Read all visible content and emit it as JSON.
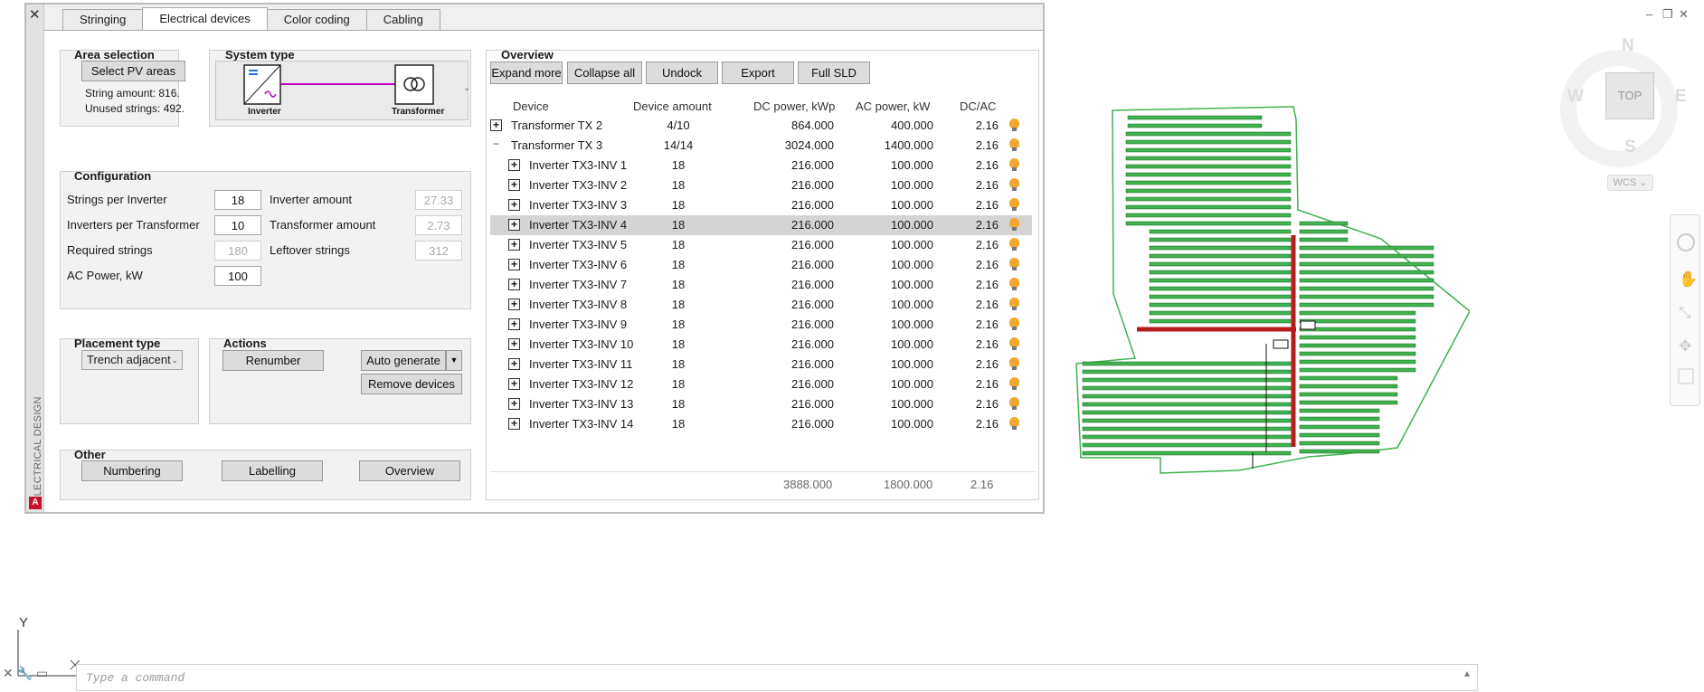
{
  "panel": {
    "close_icon": "close-icon",
    "side_title": "ELECTRICAL DESIGN",
    "app_logo": "A",
    "tabs": [
      "Stringing",
      "Electrical devices",
      "Color coding",
      "Cabling"
    ],
    "active_tab": "Electrical devices"
  },
  "area_selection": {
    "title": "Area selection",
    "button": "Select PV areas",
    "string_amount": "String amount: 816.",
    "unused_strings": "Unused strings: 492."
  },
  "system_type": {
    "title": "System type",
    "inverter_label": "Inverter",
    "transformer_label": "Transformer"
  },
  "configuration": {
    "title": "Configuration",
    "strings_per_inverter_label": "Strings per Inverter",
    "strings_per_inverter": "18",
    "inverters_per_transformer_label": "Inverters per Transformer",
    "inverters_per_transformer": "10",
    "required_strings_label": "Required strings",
    "required_strings": "180",
    "ac_power_label": "AC Power, kW",
    "ac_power": "100",
    "inverter_amount_label": "Inverter amount",
    "inverter_amount": "27.33",
    "transformer_amount_label": "Transformer amount",
    "transformer_amount": "2.73",
    "leftover_strings_label": "Leftover strings",
    "leftover_strings": "312"
  },
  "placement": {
    "title": "Placement type",
    "value": "Trench adjacent"
  },
  "actions": {
    "title": "Actions",
    "renumber": "Renumber",
    "auto_generate": "Auto generate",
    "remove_devices": "Remove devices"
  },
  "other": {
    "title": "Other",
    "numbering": "Numbering",
    "labelling": "Labelling",
    "overview": "Overview"
  },
  "overview": {
    "title": "Overview",
    "buttons": [
      "Expand more",
      "Collapse all",
      "Undock",
      "Export",
      "Full SLD"
    ],
    "columns": [
      "Device",
      "Device amount",
      "DC power, kWp",
      "AC power, kW",
      "DC/AC"
    ],
    "rows": [
      {
        "level": 0,
        "toggle": "+",
        "device": "Transformer TX 2",
        "amount": "4/10",
        "dc": "864.000",
        "ac": "400.000",
        "ratio": "2.16"
      },
      {
        "level": 0,
        "toggle": "−",
        "device": "Transformer TX 3",
        "amount": "14/14",
        "dc": "3024.000",
        "ac": "1400.000",
        "ratio": "2.16"
      },
      {
        "level": 1,
        "toggle": "+",
        "device": "Inverter TX3-INV 1",
        "amount": "18",
        "dc": "216.000",
        "ac": "100.000",
        "ratio": "2.16"
      },
      {
        "level": 1,
        "toggle": "+",
        "device": "Inverter TX3-INV 2",
        "amount": "18",
        "dc": "216.000",
        "ac": "100.000",
        "ratio": "2.16"
      },
      {
        "level": 1,
        "toggle": "+",
        "device": "Inverter TX3-INV 3",
        "amount": "18",
        "dc": "216.000",
        "ac": "100.000",
        "ratio": "2.16"
      },
      {
        "level": 1,
        "toggle": "+",
        "device": "Inverter TX3-INV 4",
        "amount": "18",
        "dc": "216.000",
        "ac": "100.000",
        "ratio": "2.16",
        "selected": true
      },
      {
        "level": 1,
        "toggle": "+",
        "device": "Inverter TX3-INV 5",
        "amount": "18",
        "dc": "216.000",
        "ac": "100.000",
        "ratio": "2.16"
      },
      {
        "level": 1,
        "toggle": "+",
        "device": "Inverter TX3-INV 6",
        "amount": "18",
        "dc": "216.000",
        "ac": "100.000",
        "ratio": "2.16"
      },
      {
        "level": 1,
        "toggle": "+",
        "device": "Inverter TX3-INV 7",
        "amount": "18",
        "dc": "216.000",
        "ac": "100.000",
        "ratio": "2.16"
      },
      {
        "level": 1,
        "toggle": "+",
        "device": "Inverter TX3-INV 8",
        "amount": "18",
        "dc": "216.000",
        "ac": "100.000",
        "ratio": "2.16"
      },
      {
        "level": 1,
        "toggle": "+",
        "device": "Inverter TX3-INV 9",
        "amount": "18",
        "dc": "216.000",
        "ac": "100.000",
        "ratio": "2.16"
      },
      {
        "level": 1,
        "toggle": "+",
        "device": "Inverter TX3-INV 10",
        "amount": "18",
        "dc": "216.000",
        "ac": "100.000",
        "ratio": "2.16"
      },
      {
        "level": 1,
        "toggle": "+",
        "device": "Inverter TX3-INV 11",
        "amount": "18",
        "dc": "216.000",
        "ac": "100.000",
        "ratio": "2.16"
      },
      {
        "level": 1,
        "toggle": "+",
        "device": "Inverter TX3-INV 12",
        "amount": "18",
        "dc": "216.000",
        "ac": "100.000",
        "ratio": "2.16"
      },
      {
        "level": 1,
        "toggle": "+",
        "device": "Inverter TX3-INV 13",
        "amount": "18",
        "dc": "216.000",
        "ac": "100.000",
        "ratio": "2.16"
      },
      {
        "level": 1,
        "toggle": "+",
        "device": "Inverter TX3-INV 14",
        "amount": "18",
        "dc": "216.000",
        "ac": "100.000",
        "ratio": "2.16"
      }
    ],
    "totals": {
      "dc": "3888.000",
      "ac": "1800.000",
      "ratio": "2.16"
    }
  },
  "viewcube": {
    "north": "N",
    "south": "S",
    "east": "E",
    "west": "W",
    "top": "TOP",
    "wcs": "WCS"
  },
  "ucs": {
    "y_label": "Y"
  },
  "command": {
    "placeholder": "Type a command"
  },
  "colors": {
    "pv_green": "#3fb34f",
    "trench_red": "#b71c1c",
    "system_link": "#c000c0",
    "selected_row": "#d4d4d4",
    "bulb": "#f0a830"
  }
}
